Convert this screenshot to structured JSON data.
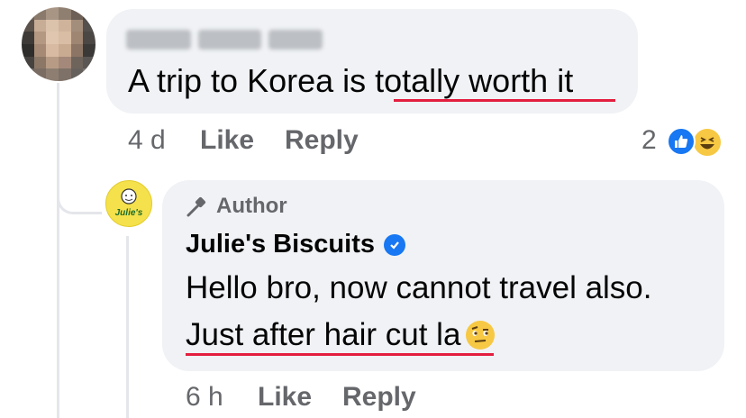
{
  "comment": {
    "text": "A trip to Korea is totally worth it",
    "time": "4 d",
    "like_label": "Like",
    "reply_label": "Reply",
    "reaction_count": "2",
    "reactions": [
      "like-icon",
      "haha-icon"
    ]
  },
  "reply": {
    "badge_label": "Author",
    "author_name": "Julie's Biscuits",
    "line1": "Hello bro, now cannot travel also.",
    "line2": "Just after hair cut la",
    "time": "6 h",
    "like_label": "Like",
    "reply_label": "Reply",
    "logo_text": "Julie's"
  },
  "colors": {
    "bubble": "#f0f2f5",
    "underline": "#e41e3f",
    "fb_blue": "#1877f2",
    "meta_gray": "#65676b"
  }
}
